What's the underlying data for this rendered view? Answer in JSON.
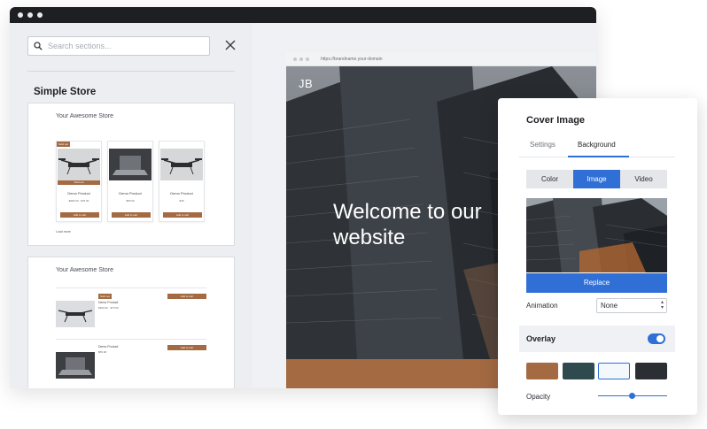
{
  "window": {
    "dots": 3
  },
  "sidebar": {
    "search_placeholder": "Search sections...",
    "section_title": "Simple Store",
    "thumbnail_1": {
      "store_title": "Your Awesome Store",
      "cards": [
        {
          "badge": "Sold out",
          "sold_label": "Sold out",
          "name": "Demo Product",
          "price": "$900.00 · $75.00",
          "cart": "Add to cart",
          "image": "drone"
        },
        {
          "badge": "",
          "sold_label": "",
          "name": "Demo Product",
          "price": "$55.00",
          "cart": "Add to cart",
          "image": "laptop"
        },
        {
          "badge": "",
          "sold_label": "",
          "name": "Demo Product",
          "price": "$45",
          "cart": "Add to cart",
          "image": "drone"
        }
      ],
      "load_more": "Load more"
    },
    "thumbnail_2": {
      "store_title": "Your Awesome Store",
      "rows": [
        {
          "badge": "Sold out",
          "name": "Demo Product",
          "price": "$900.00 · $75.00",
          "cart": "Add to cart",
          "image": "drone"
        },
        {
          "badge": "",
          "name": "Demo Product",
          "price": "$55.00",
          "cart": "Add to cart",
          "image": "laptop"
        }
      ]
    }
  },
  "preview": {
    "url": "https://brandname.your-domain",
    "logo": "JB",
    "hero_title": "Welcome to our website"
  },
  "panel": {
    "title": "Cover Image",
    "tabs": [
      {
        "label": "Settings"
      },
      {
        "label": "Background"
      }
    ],
    "active_tab": "Background",
    "segments": [
      {
        "label": "Color"
      },
      {
        "label": "Image"
      },
      {
        "label": "Video"
      }
    ],
    "active_segment": "Image",
    "replace_label": "Replace",
    "animation_label": "Animation",
    "animation_value": "None",
    "overlay_label": "Overlay",
    "overlay_enabled": true,
    "swatches": [
      "#a46a42",
      "#2e4a4f",
      "#f4f7fb",
      "#2b2e33"
    ],
    "selected_swatch": 2,
    "opacity_label": "Opacity",
    "opacity_value": 0.5
  },
  "colors": {
    "accent": "#2f6fd6",
    "brand_brown": "#a46a42",
    "dark": "#1e1f23"
  }
}
